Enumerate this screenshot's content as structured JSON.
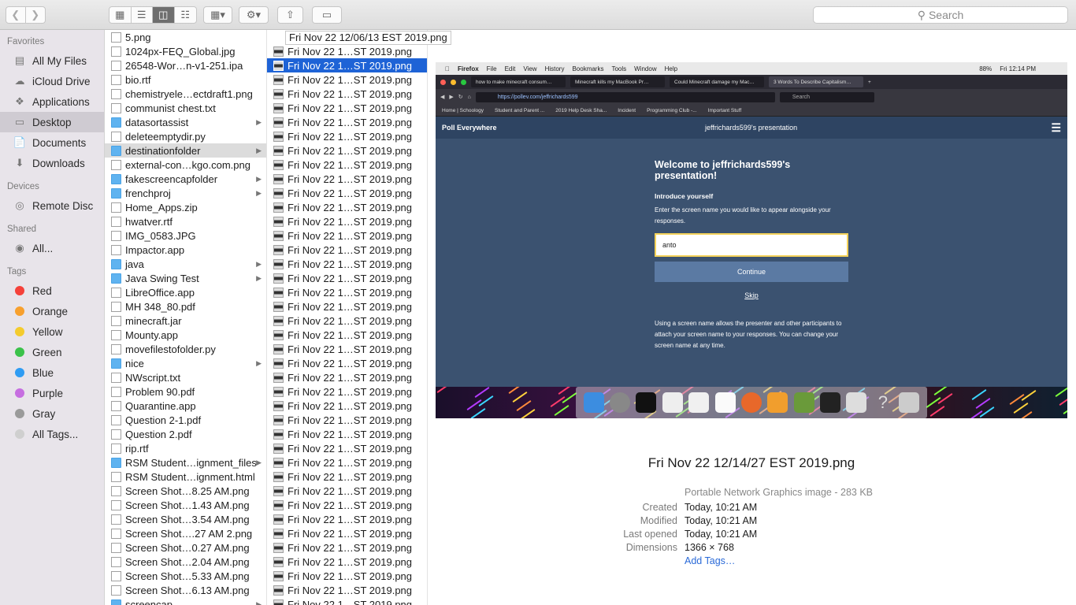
{
  "toolbar": {
    "search_placeholder": "Search"
  },
  "sidebar": {
    "favorites_heading": "Favorites",
    "favorites": [
      {
        "label": "All My Files",
        "icon": "all-files-icon"
      },
      {
        "label": "iCloud Drive",
        "icon": "cloud-icon"
      },
      {
        "label": "Applications",
        "icon": "applications-icon"
      },
      {
        "label": "Desktop",
        "icon": "desktop-icon"
      },
      {
        "label": "Documents",
        "icon": "documents-icon"
      },
      {
        "label": "Downloads",
        "icon": "downloads-icon"
      }
    ],
    "devices_heading": "Devices",
    "devices": [
      {
        "label": "Remote Disc"
      }
    ],
    "shared_heading": "Shared",
    "shared": [
      {
        "label": "All..."
      }
    ],
    "tags_heading": "Tags",
    "tags": [
      {
        "label": "Red",
        "color": "#f5413a"
      },
      {
        "label": "Orange",
        "color": "#f7a02e"
      },
      {
        "label": "Yellow",
        "color": "#f4cb2d"
      },
      {
        "label": "Green",
        "color": "#3bc24a"
      },
      {
        "label": "Blue",
        "color": "#2f9cf3"
      },
      {
        "label": "Purple",
        "color": "#c66ee0"
      },
      {
        "label": "Gray",
        "color": "#9a9a9a"
      },
      {
        "label": "All Tags...",
        "color": "#cfcfcf"
      }
    ]
  },
  "column1": [
    "5.png",
    "1024px-FEQ_Global.jpg",
    "26548-Wor…n-v1-251.ipa",
    "bio.rtf",
    "chemistryele…ectdraft1.png",
    "communist chest.txt",
    "datasortassist",
    "deleteemptydir.py",
    "destinationfolder",
    "external-con…kgo.com.png",
    "fakescreencapfolder",
    "frenchproj",
    "Home_Apps.zip",
    "hwatver.rtf",
    "IMG_0583.JPG",
    "Impactor.app",
    "java",
    "Java Swing Test",
    "LibreOffice.app",
    "MH 348_80.pdf",
    "minecraft.jar",
    "Mounty.app",
    "movefilestofolder.py",
    "nice",
    "NWscript.txt",
    "Problem 90.pdf",
    "Quarantine.app",
    "Question 2-1.pdf",
    "Question 2.pdf",
    "rip.rtf",
    "RSM Student…ignment_files",
    "RSM Student…ignment.html",
    "Screen Shot…8.25 AM.png",
    "Screen Shot…1.43 AM.png",
    "Screen Shot…3.54 AM.png",
    "Screen Shot….27 AM 2.png",
    "Screen Shot…0.27 AM.png",
    "Screen Shot…2.04 AM.png",
    "Screen Shot…5.33 AM.png",
    "Screen Shot…6.13 AM.png",
    "screencap"
  ],
  "column2": {
    "tooltip": "Fri Nov 22 12/06/13 EST 2019.png",
    "item_label": "Fri Nov 22 1…ST 2019.png",
    "count": 41
  },
  "preview": {
    "mac_menu": [
      "Firefox",
      "File",
      "Edit",
      "View",
      "History",
      "Bookmarks",
      "Tools",
      "Window",
      "Help"
    ],
    "battery": "88%",
    "clock": "Fri 12:14 PM",
    "tabs": [
      "how to make minecraft consum…",
      "Minecraft kills my MacBook Pr…",
      "Could Minecraft damage my Mac…",
      "3 Words To Describe Capitalism…"
    ],
    "url": "https://pollev.com/jeffrichards599",
    "url_search": "Search",
    "bookmarks": [
      "Home | Schoology",
      "Student and Parent ...",
      "2019 Help Desk Sha...",
      "Incident",
      "Programming Club -...",
      "Important Stuff"
    ],
    "brand": "Poll Everywhere",
    "presentation": "jeffrichards599's presentation",
    "welcome": "Welcome to jeffrichards599's presentation!",
    "introduce": "Introduce yourself",
    "instructions": "Enter the screen name you would like to appear alongside your responses.",
    "input_value": "anto",
    "continue": "Continue",
    "skip": "Skip",
    "note": "Using a screen name allows the presenter and other participants to attach your screen name to your responses. You can change your screen name at any time."
  },
  "info": {
    "filename": "Fri Nov 22 12/14/27 EST 2019.png",
    "kind": "Portable Network Graphics image - 283 KB",
    "created_label": "Created",
    "created": "Today, 10:21 AM",
    "modified_label": "Modified",
    "modified": "Today, 10:21 AM",
    "opened_label": "Last opened",
    "opened": "Today, 10:21 AM",
    "dimensions_label": "Dimensions",
    "dimensions": "1366 × 768",
    "add_tags": "Add Tags…"
  }
}
